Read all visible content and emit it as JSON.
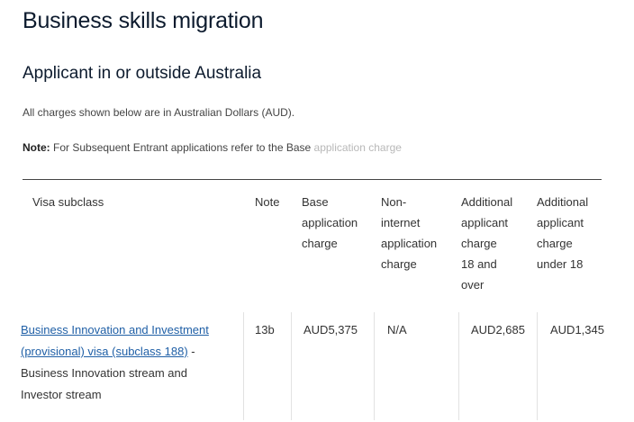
{
  "page": {
    "title": "Business skills migration",
    "section_heading": "Applicant in or outside Australia",
    "intro": "All charges shown below are in Australian Dollars (AUD).",
    "note_label": "Note:",
    "note_body": " For Subsequent Entrant applications refer to the Base",
    "note_faded": " application charge"
  },
  "table": {
    "headers": {
      "visa_subclass": "Visa subclass",
      "note": "Note",
      "base_charge": [
        "Base",
        "application",
        "charge"
      ],
      "non_internet": [
        "Non-",
        "internet",
        "application",
        "charge"
      ],
      "additional_18_over": [
        "Additional",
        "applicant",
        "charge",
        "18 and",
        "over"
      ],
      "additional_under_18": [
        "Additional",
        "applicant",
        "charge",
        "under 18"
      ]
    },
    "rows": [
      {
        "visa_link_lines": [
          "Business Innovation and Investment",
          "(provisional) visa (subclass 188)"
        ],
        "visa_suffix": " -",
        "visa_description_lines": [
          "Business Innovation stream and",
          "Investor stream"
        ],
        "note": "13b",
        "base_charge": "AUD5,375",
        "non_internet": "N/A",
        "additional_18_over": "AUD2,685",
        "additional_under_18": "AUD1,345"
      }
    ]
  }
}
